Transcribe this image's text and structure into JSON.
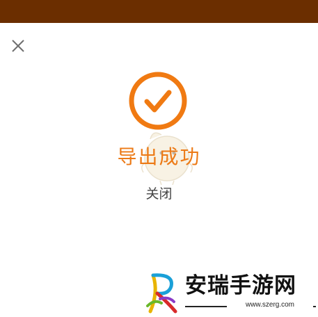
{
  "dialog": {
    "close_icon": "close-icon",
    "status_icon": "checkmark-circle-icon",
    "title": "导出成功",
    "close_label": "关闭",
    "accent_color": "#ec7a16",
    "header_bar_color": "#6b2e00"
  },
  "watermark": {
    "site_name": "安瑞手游网",
    "url": "www.szerg.com"
  }
}
